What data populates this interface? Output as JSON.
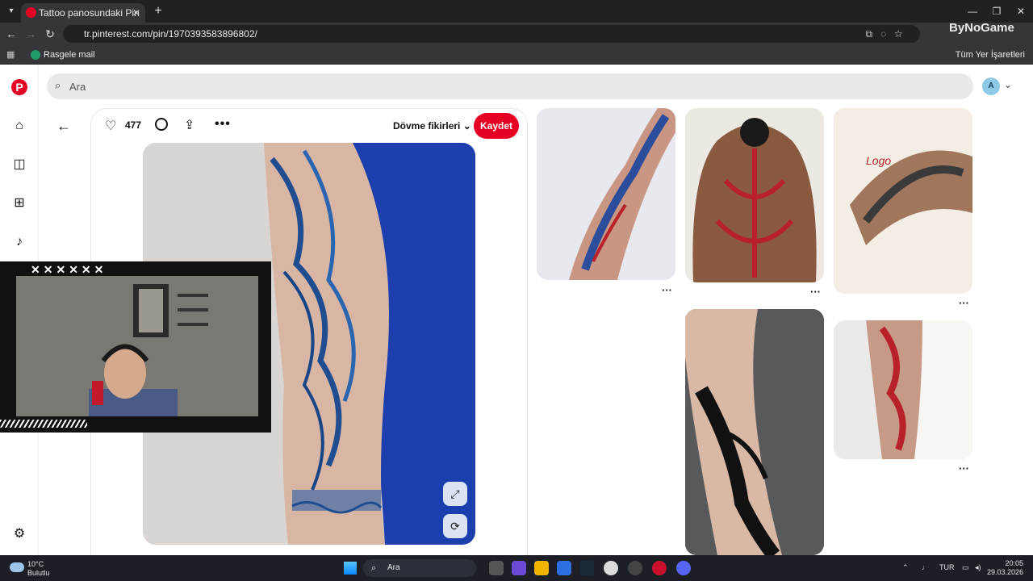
{
  "browser": {
    "tab_title": "Tattoo panosundaki Pin",
    "url": "tr.pinterest.com/pin/1970393583896802/",
    "bookmark": "Rasgele mail",
    "bookmarks_folder": "Tüm Yer İşaretleri",
    "extension_logo": "ByNoGame"
  },
  "search": {
    "placeholder": "Ara"
  },
  "avatar": {
    "initial": "A"
  },
  "pin": {
    "likes": "477",
    "board": "Dövme fikirleri",
    "save_label": "Kaydet"
  },
  "taskbar": {
    "temp": "10°C",
    "weather": "Bulutlu",
    "search_placeholder": "Ara",
    "language": "TUR",
    "time": "20:05",
    "date": "29.03.2026"
  },
  "colors": {
    "brand": "#e60023",
    "tattoo_blue": "#1f4d8f",
    "tattoo_red": "#b8202a"
  }
}
